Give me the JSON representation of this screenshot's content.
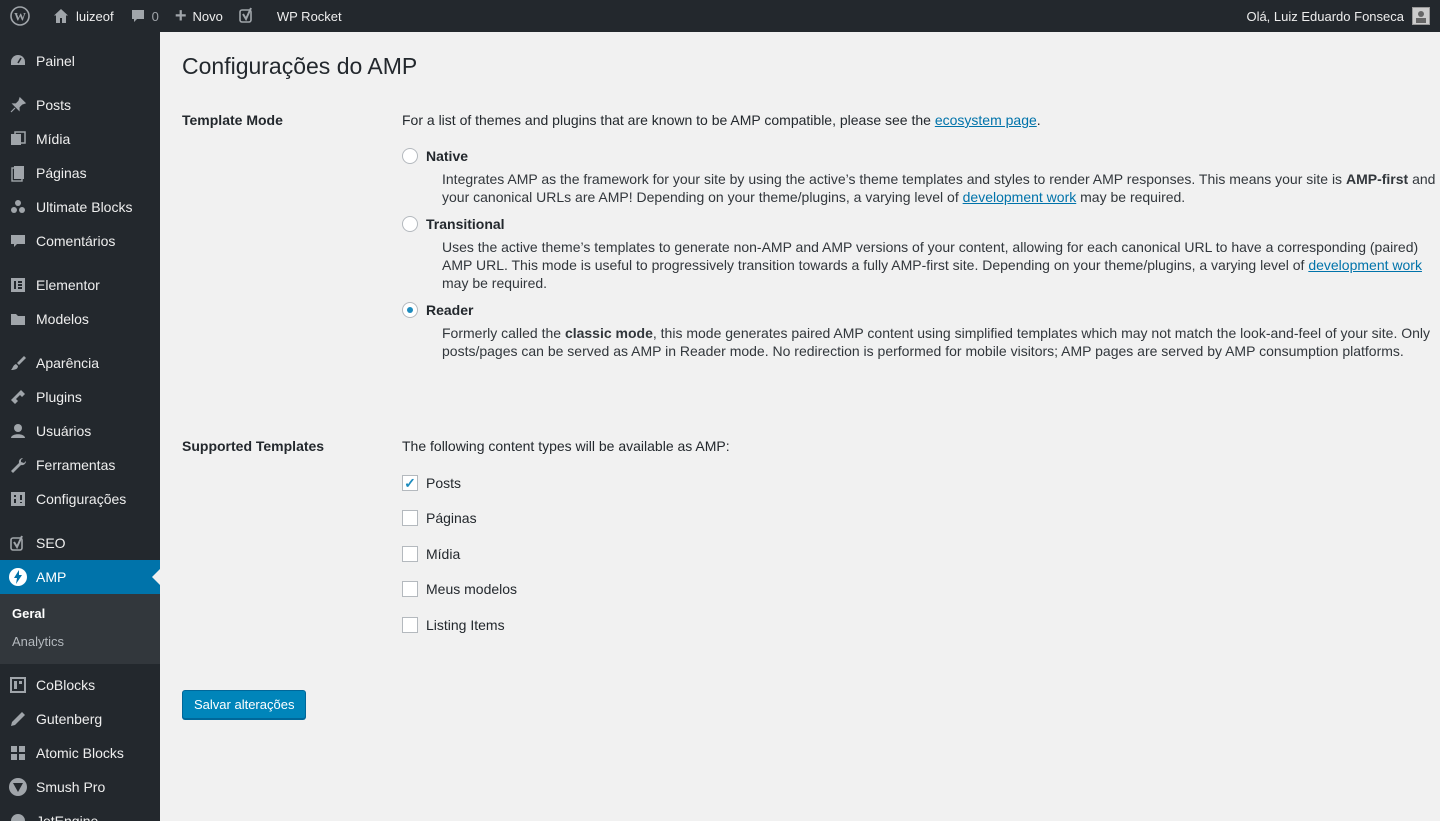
{
  "adminbar": {
    "wp_logo_icon": "wordpress-logo-icon",
    "site_name": "luizeof",
    "comments_count": "0",
    "new_label": "Novo",
    "yoast_icon": "yoast-icon",
    "wp_rocket_label": "WP Rocket",
    "greeting": "Olá, Luiz Eduardo Fonseca"
  },
  "sidebar": {
    "items": [
      {
        "label": "Painel",
        "icon": "dashboard-icon"
      },
      {
        "label": "Posts",
        "icon": "pin-icon"
      },
      {
        "label": "Mídia",
        "icon": "media-icon"
      },
      {
        "label": "Páginas",
        "icon": "pages-icon"
      },
      {
        "label": "Ultimate Blocks",
        "icon": "blocks-icon"
      },
      {
        "label": "Comentários",
        "icon": "comments-icon"
      },
      {
        "label": "Elementor",
        "icon": "elementor-icon"
      },
      {
        "label": "Modelos",
        "icon": "folder-icon"
      },
      {
        "label": "Aparência",
        "icon": "brush-icon"
      },
      {
        "label": "Plugins",
        "icon": "plugin-icon"
      },
      {
        "label": "Usuários",
        "icon": "user-icon"
      },
      {
        "label": "Ferramentas",
        "icon": "wrench-icon"
      },
      {
        "label": "Configurações",
        "icon": "settings-icon"
      },
      {
        "label": "SEO",
        "icon": "yoast-icon"
      },
      {
        "label": "AMP",
        "icon": "amp-icon"
      },
      {
        "label": "CoBlocks",
        "icon": "coblocks-icon"
      },
      {
        "label": "Gutenberg",
        "icon": "pencil-icon"
      },
      {
        "label": "Atomic Blocks",
        "icon": "grid-icon"
      },
      {
        "label": "Smush Pro",
        "icon": "smush-icon"
      },
      {
        "label": "JetEngine",
        "icon": "jetengine-icon"
      }
    ],
    "submenu": [
      {
        "label": "Geral"
      },
      {
        "label": "Analytics"
      }
    ]
  },
  "page": {
    "title": "Configurações do AMP",
    "template_mode": {
      "label": "Template Mode",
      "intro_prefix": "For a list of themes and plugins that are known to be AMP compatible, please see the ",
      "intro_link": "ecosystem page",
      "intro_suffix": ".",
      "options": [
        {
          "label": "Native",
          "selected": false,
          "desc_1": "Integrates AMP as the framework for your site by using the active’s theme templates and styles to render AMP responses. This means your site is ",
          "desc_bold": "AMP-first",
          "desc_2": " and your canonical URLs are AMP! Depending on your theme/plugins, a varying level of ",
          "desc_link": "development work",
          "desc_3": " may be required."
        },
        {
          "label": "Transitional",
          "selected": false,
          "desc_1": "Uses the active theme’s templates to generate non-AMP and AMP versions of your content, allowing for each canonical URL to have a corresponding (paired) AMP URL. This mode is useful to progressively transition towards a fully AMP-first site. Depending on your theme/plugins, a varying level of ",
          "desc_link": "development work",
          "desc_2": " may be required."
        },
        {
          "label": "Reader",
          "selected": true,
          "desc_1": "Formerly called the ",
          "desc_bold": "classic mode",
          "desc_2": ", this mode generates paired AMP content using simplified templates which may not match the look-and-feel of your site. Only posts/pages can be served as AMP in Reader mode. No redirection is performed for mobile visitors; AMP pages are served by AMP consumption platforms."
        }
      ]
    },
    "supported_templates": {
      "label": "Supported Templates",
      "intro": "The following content types will be available as AMP:",
      "options": [
        {
          "label": "Posts",
          "checked": true
        },
        {
          "label": "Páginas",
          "checked": false
        },
        {
          "label": "Mídia",
          "checked": false
        },
        {
          "label": "Meus modelos",
          "checked": false
        },
        {
          "label": "Listing Items",
          "checked": false
        }
      ]
    },
    "save_button": "Salvar alterações"
  },
  "colors": {
    "adminbar_bg": "#23282d",
    "sidebar_bg": "#23282d",
    "active_menu": "#0073aa",
    "link": "#0073aa",
    "button": "#0085ba"
  }
}
